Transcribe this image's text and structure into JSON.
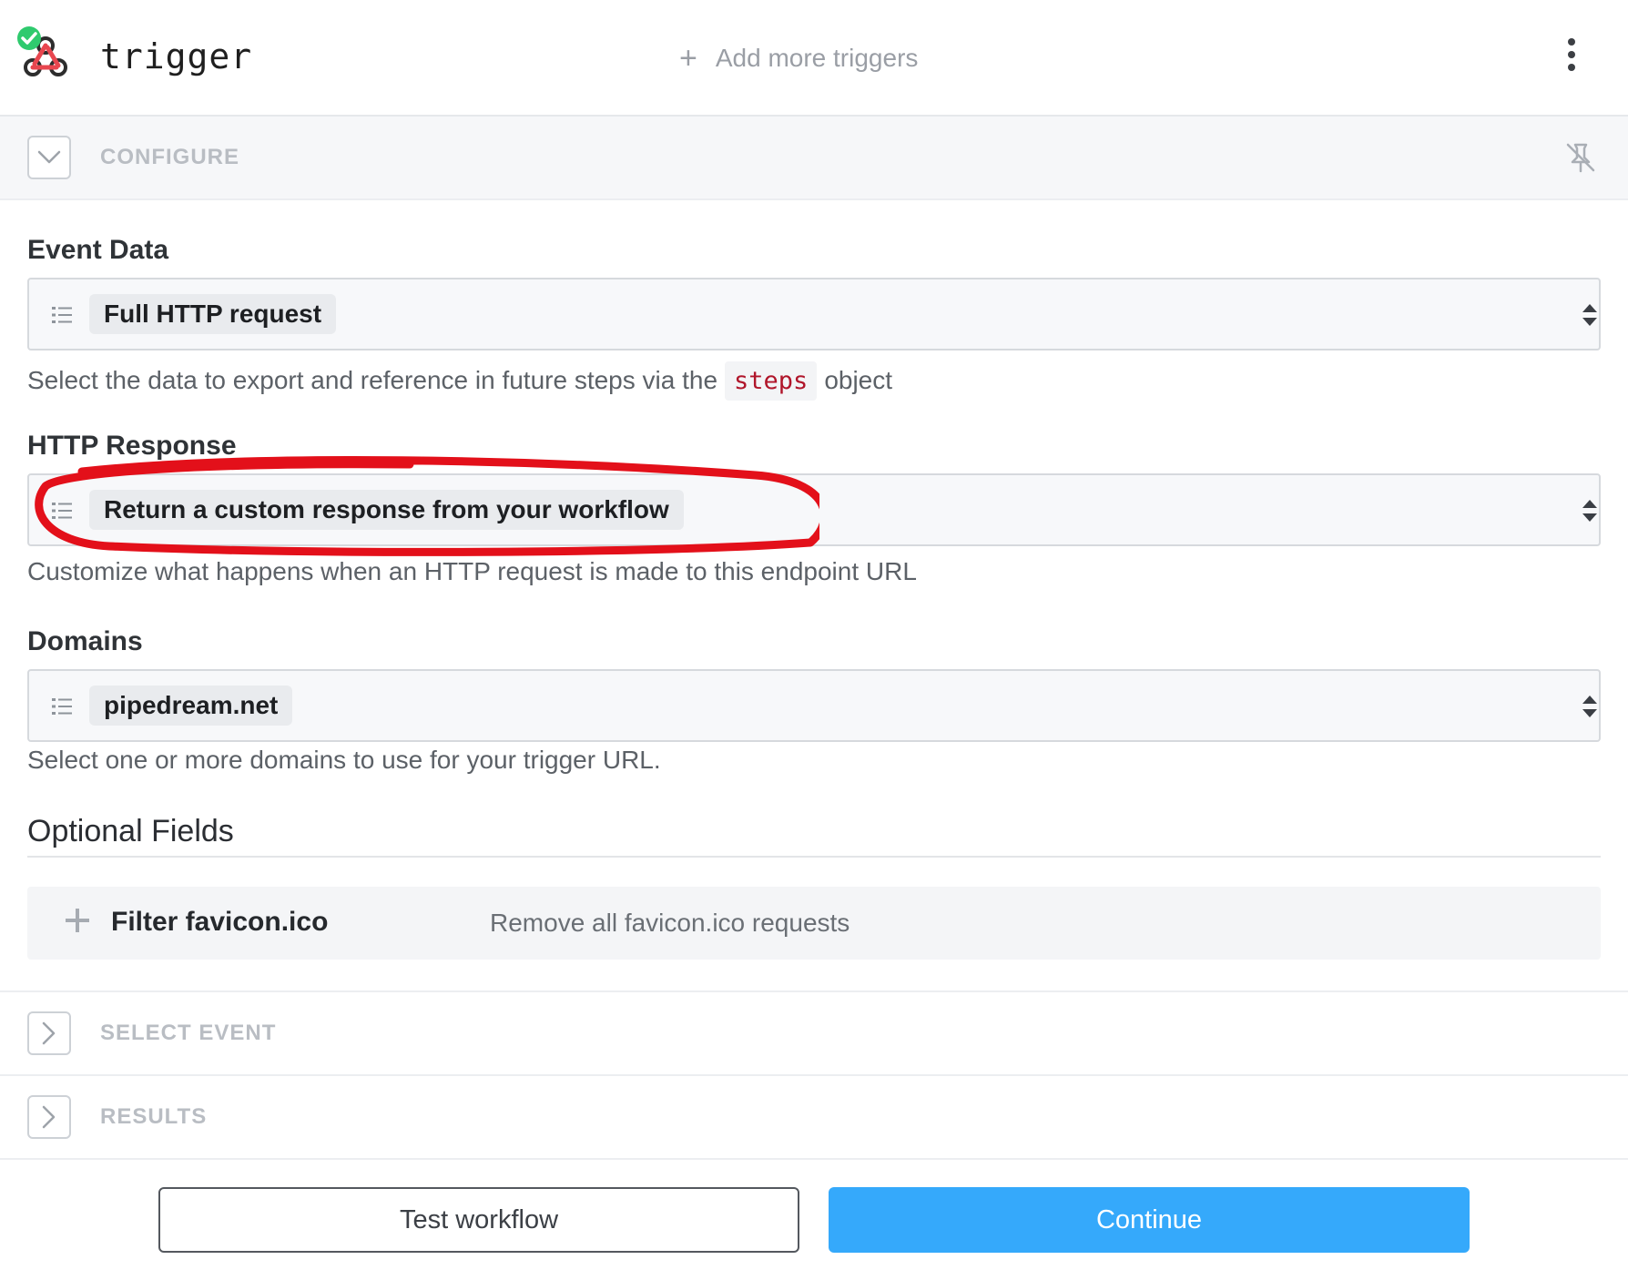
{
  "header": {
    "title": "trigger",
    "add_triggers_label": "Add more triggers"
  },
  "sections": {
    "configure": "CONFIGURE",
    "select_event": "SELECT EVENT",
    "results": "RESULTS"
  },
  "fields": {
    "event_data": {
      "label": "Event Data",
      "value": "Full HTTP request",
      "help_before": "Select the data to export and reference in future steps via the",
      "help_code": "steps",
      "help_after": "object"
    },
    "http_response": {
      "label": "HTTP Response",
      "value": "Return a custom response from your workflow",
      "help": "Customize what happens when an HTTP request is made to this endpoint URL"
    },
    "domains": {
      "label": "Domains",
      "value": "pipedream.net",
      "help": "Select one or more domains to use for your trigger URL."
    }
  },
  "optional": {
    "title": "Optional Fields",
    "items": [
      {
        "name": "Filter favicon.ico",
        "description": "Remove all favicon.ico requests"
      }
    ]
  },
  "footer": {
    "test_label": "Test workflow",
    "continue_label": "Continue"
  },
  "colors": {
    "accent": "#35a9fb",
    "status_ok": "#2fca6e",
    "code_text": "#b0152a",
    "annotation": "#e3101a"
  },
  "icons": {
    "trigger_logo": "webhook-icon",
    "status": "check-circle-icon",
    "menu": "kebab-menu-icon",
    "pin": "pin-off-icon",
    "select_prefix": "list-icon",
    "select_suffix": "sort-arrows-icon"
  }
}
